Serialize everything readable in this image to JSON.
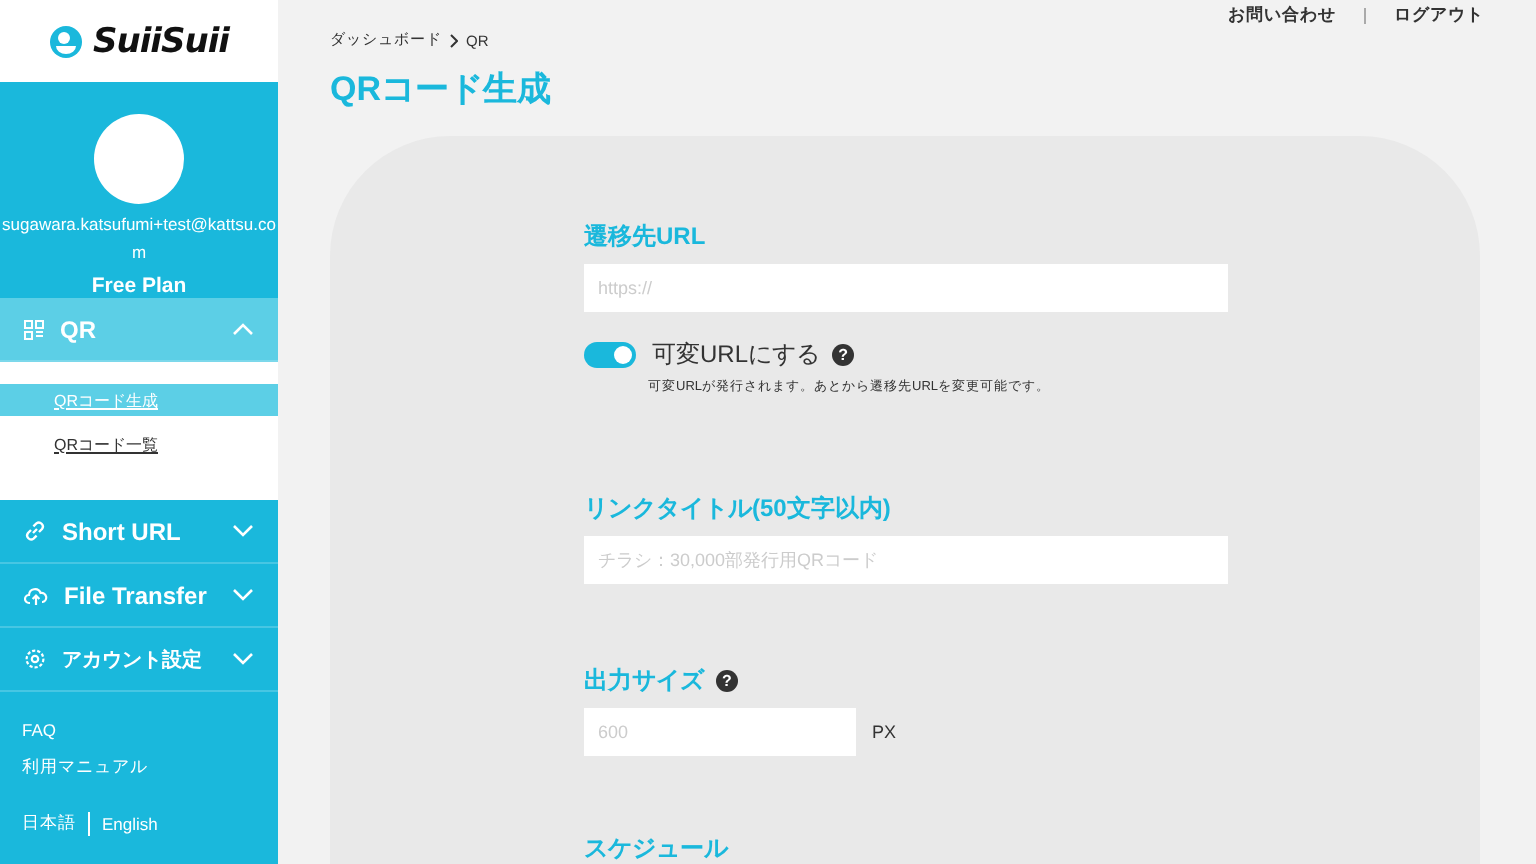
{
  "logo": {
    "text": "SuiiSuii"
  },
  "profile": {
    "email": "sugawara.katsufumi+test@kattsu.com",
    "plan": "Free Plan"
  },
  "nav": [
    {
      "label": "QR",
      "expanded": true,
      "children": [
        {
          "label": "QRコード生成",
          "selected": true
        },
        {
          "label": "QRコード一覧",
          "selected": false
        }
      ]
    },
    {
      "label": "Short URL",
      "expanded": false
    },
    {
      "label": "File Transfer",
      "expanded": false
    },
    {
      "label": "アカウント設定",
      "expanded": false
    }
  ],
  "footer_links": [
    "FAQ",
    "利用マニュアル"
  ],
  "languages": [
    "日本語",
    "English"
  ],
  "header_links": [
    "お問い合わせ",
    "ログアウト"
  ],
  "breadcrumb": [
    "ダッシュボード",
    "QR"
  ],
  "title": "QRコード生成",
  "form": [
    {
      "kind": "input",
      "label": "遷移先URL",
      "placeholder": "https://"
    },
    {
      "kind": "toggle",
      "label": "可変URLにする",
      "on": true,
      "help": "?",
      "note": "可変URLが発行されます。あとから遷移先URLを変更可能です。"
    },
    {
      "kind": "input",
      "label": "リンクタイトル(50文字以内)",
      "placeholder": "チラシ：30,000部発行用QRコード"
    },
    {
      "kind": "size",
      "label": "出力サイズ",
      "help": "?",
      "placeholder": "600",
      "unit": "PX"
    },
    {
      "kind": "heading",
      "label": "スケジュール"
    }
  ]
}
